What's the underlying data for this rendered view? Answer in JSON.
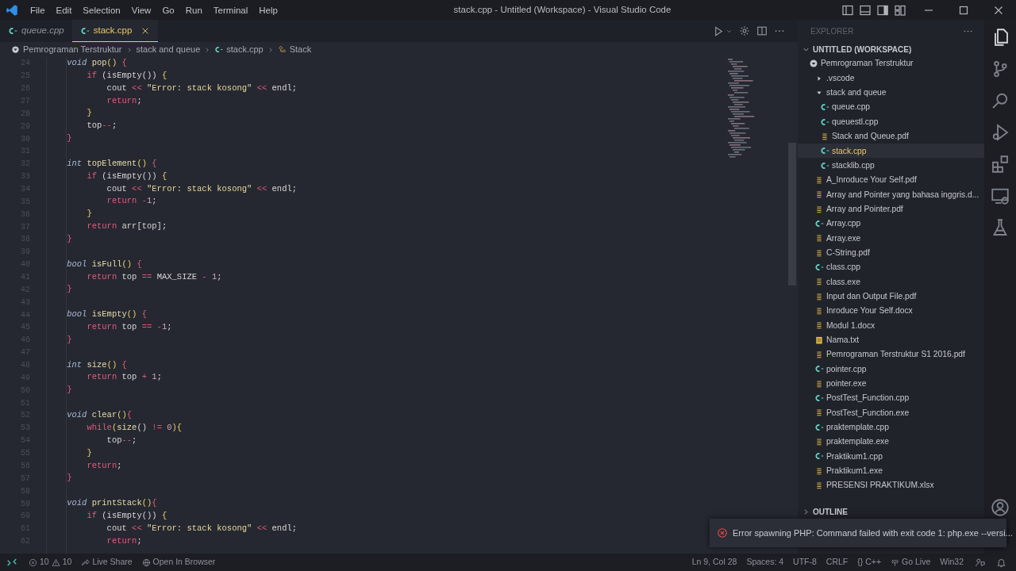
{
  "window": {
    "title": "stack.cpp - Untitled (Workspace) - Visual Studio Code"
  },
  "menu": [
    "File",
    "Edit",
    "Selection",
    "View",
    "Go",
    "Run",
    "Terminal",
    "Help"
  ],
  "tabs": [
    {
      "label": "queue.cpp",
      "selected": false,
      "preview": true
    },
    {
      "label": "stack.cpp",
      "selected": true,
      "preview": false
    }
  ],
  "breadcrumbs": [
    {
      "label": "Pemrograman Terstruktur",
      "kind": "root"
    },
    {
      "label": "stack and queue",
      "kind": "folder"
    },
    {
      "label": "stack.cpp",
      "kind": "cpp"
    },
    {
      "label": "Stack",
      "kind": "class"
    }
  ],
  "editor": {
    "lines": [
      {
        "number": "24",
        "tokens": [
          {
            "kind": "type",
            "text": "    void "
          },
          {
            "kind": "fn",
            "text": "pop"
          },
          {
            "kind": "b2",
            "text": "() "
          },
          {
            "kind": "b1",
            "text": "{"
          }
        ]
      },
      {
        "number": "25",
        "tokens": [
          {
            "kind": "kw",
            "text": "        if "
          },
          {
            "kind": "plain",
            "text": "(isEmpty()) "
          },
          {
            "kind": "b2",
            "text": "{"
          }
        ]
      },
      {
        "number": "26",
        "tokens": [
          {
            "kind": "plain",
            "text": "            cout "
          },
          {
            "kind": "op",
            "text": "<< "
          },
          {
            "kind": "str",
            "text": "\"Error: stack kosong\" "
          },
          {
            "kind": "op",
            "text": "<< "
          },
          {
            "kind": "plain",
            "text": "endl;"
          }
        ]
      },
      {
        "number": "27",
        "tokens": [
          {
            "kind": "kw",
            "text": "            return"
          },
          {
            "kind": "plain",
            "text": ";"
          }
        ]
      },
      {
        "number": "28",
        "tokens": [
          {
            "kind": "b2",
            "text": "        }"
          }
        ]
      },
      {
        "number": "29",
        "tokens": [
          {
            "kind": "plain",
            "text": "        top"
          },
          {
            "kind": "op",
            "text": "--"
          },
          {
            "kind": "plain",
            "text": ";"
          }
        ]
      },
      {
        "number": "30",
        "tokens": [
          {
            "kind": "b1",
            "text": "    }"
          }
        ]
      },
      {
        "number": "31"
      },
      {
        "number": "32",
        "tokens": [
          {
            "kind": "type",
            "text": "    int "
          },
          {
            "kind": "fn",
            "text": "topElement"
          },
          {
            "kind": "b2",
            "text": "() "
          },
          {
            "kind": "b1",
            "text": "{"
          }
        ]
      },
      {
        "number": "33",
        "tokens": [
          {
            "kind": "kw",
            "text": "        if "
          },
          {
            "kind": "plain",
            "text": "(isEmpty()) "
          },
          {
            "kind": "b2",
            "text": "{"
          }
        ]
      },
      {
        "number": "34",
        "tokens": [
          {
            "kind": "plain",
            "text": "            cout "
          },
          {
            "kind": "op",
            "text": "<< "
          },
          {
            "kind": "str",
            "text": "\"Error: stack kosong\" "
          },
          {
            "kind": "op",
            "text": "<< "
          },
          {
            "kind": "plain",
            "text": "endl;"
          }
        ]
      },
      {
        "number": "35",
        "tokens": [
          {
            "kind": "kw",
            "text": "            return "
          },
          {
            "kind": "op",
            "text": "-"
          },
          {
            "kind": "num",
            "text": "1"
          },
          {
            "kind": "plain",
            "text": ";"
          }
        ]
      },
      {
        "number": "36",
        "tokens": [
          {
            "kind": "b2",
            "text": "        }"
          }
        ]
      },
      {
        "number": "37",
        "tokens": [
          {
            "kind": "kw",
            "text": "        return "
          },
          {
            "kind": "plain",
            "text": "arr[top];"
          }
        ]
      },
      {
        "number": "38",
        "tokens": [
          {
            "kind": "b1",
            "text": "    }"
          }
        ]
      },
      {
        "number": "39"
      },
      {
        "number": "40",
        "tokens": [
          {
            "kind": "type",
            "text": "    bool "
          },
          {
            "kind": "fn",
            "text": "isFull"
          },
          {
            "kind": "b2",
            "text": "() "
          },
          {
            "kind": "b1",
            "text": "{"
          }
        ]
      },
      {
        "number": "41",
        "tokens": [
          {
            "kind": "kw",
            "text": "        return "
          },
          {
            "kind": "plain",
            "text": "top "
          },
          {
            "kind": "op",
            "text": "== "
          },
          {
            "kind": "plain",
            "text": "MAX_SIZE "
          },
          {
            "kind": "op",
            "text": "- "
          },
          {
            "kind": "num",
            "text": "1"
          },
          {
            "kind": "plain",
            "text": ";"
          }
        ]
      },
      {
        "number": "42",
        "tokens": [
          {
            "kind": "b1",
            "text": "    }"
          }
        ]
      },
      {
        "number": "43"
      },
      {
        "number": "44",
        "tokens": [
          {
            "kind": "type",
            "text": "    bool "
          },
          {
            "kind": "fn",
            "text": "isEmpty"
          },
          {
            "kind": "b2",
            "text": "() "
          },
          {
            "kind": "b1",
            "text": "{"
          }
        ]
      },
      {
        "number": "45",
        "tokens": [
          {
            "kind": "kw",
            "text": "        return "
          },
          {
            "kind": "plain",
            "text": "top "
          },
          {
            "kind": "op",
            "text": "== -"
          },
          {
            "kind": "num",
            "text": "1"
          },
          {
            "kind": "plain",
            "text": ";"
          }
        ]
      },
      {
        "number": "46",
        "tokens": [
          {
            "kind": "b1",
            "text": "    }"
          }
        ]
      },
      {
        "number": "47"
      },
      {
        "number": "48",
        "tokens": [
          {
            "kind": "type",
            "text": "    int "
          },
          {
            "kind": "fn",
            "text": "size"
          },
          {
            "kind": "b2",
            "text": "() "
          },
          {
            "kind": "b1",
            "text": "{"
          }
        ]
      },
      {
        "number": "49",
        "tokens": [
          {
            "kind": "kw",
            "text": "        return "
          },
          {
            "kind": "plain",
            "text": "top "
          },
          {
            "kind": "op",
            "text": "+ "
          },
          {
            "kind": "num",
            "text": "1"
          },
          {
            "kind": "plain",
            "text": ";"
          }
        ]
      },
      {
        "number": "50",
        "tokens": [
          {
            "kind": "b1",
            "text": "    }"
          }
        ]
      },
      {
        "number": "51"
      },
      {
        "number": "52",
        "tokens": [
          {
            "kind": "type",
            "text": "    void "
          },
          {
            "kind": "fn",
            "text": "clear"
          },
          {
            "kind": "b2",
            "text": "()"
          },
          {
            "kind": "b1",
            "text": "{"
          }
        ]
      },
      {
        "number": "53",
        "tokens": [
          {
            "kind": "kw",
            "text": "        while"
          },
          {
            "kind": "b2",
            "text": "("
          },
          {
            "kind": "fn",
            "text": "size"
          },
          {
            "kind": "plain",
            "text": "() "
          },
          {
            "kind": "op",
            "text": "!= "
          },
          {
            "kind": "num",
            "text": "0"
          },
          {
            "kind": "b2",
            "text": "){"
          }
        ]
      },
      {
        "number": "54",
        "tokens": [
          {
            "kind": "plain",
            "text": "            top"
          },
          {
            "kind": "op",
            "text": "--"
          },
          {
            "kind": "plain",
            "text": ";"
          }
        ]
      },
      {
        "number": "55",
        "tokens": [
          {
            "kind": "b2",
            "text": "        }"
          }
        ]
      },
      {
        "number": "56",
        "tokens": [
          {
            "kind": "kw",
            "text": "        return"
          },
          {
            "kind": "plain",
            "text": ";"
          }
        ]
      },
      {
        "number": "57",
        "tokens": [
          {
            "kind": "b1",
            "text": "    }"
          }
        ]
      },
      {
        "number": "58"
      },
      {
        "number": "59",
        "tokens": [
          {
            "kind": "type",
            "text": "    void "
          },
          {
            "kind": "fn",
            "text": "printStack"
          },
          {
            "kind": "b2",
            "text": "()"
          },
          {
            "kind": "b1",
            "text": "{"
          }
        ]
      },
      {
        "number": "60",
        "tokens": [
          {
            "kind": "kw",
            "text": "        if "
          },
          {
            "kind": "plain",
            "text": "(isEmpty()) "
          },
          {
            "kind": "b2",
            "text": "{"
          }
        ]
      },
      {
        "number": "61",
        "tokens": [
          {
            "kind": "plain",
            "text": "            cout "
          },
          {
            "kind": "op",
            "text": "<< "
          },
          {
            "kind": "str",
            "text": "\"Error: stack kosong\" "
          },
          {
            "kind": "op",
            "text": "<< "
          },
          {
            "kind": "plain",
            "text": "endl;"
          }
        ]
      },
      {
        "number": "62",
        "tokens": [
          {
            "kind": "kw",
            "text": "            return"
          },
          {
            "kind": "plain",
            "text": ";"
          }
        ]
      }
    ]
  },
  "explorer": {
    "title": "EXPLORER",
    "workspace": {
      "label": "UNTITLED (WORKSPACE)",
      "expanded": true
    },
    "tree": [
      {
        "label": "Pemrograman Terstruktur",
        "kind": "root",
        "selected": false,
        "children": [
          {
            "label": ".vscode",
            "kind": "folder",
            "expanded": false,
            "selected": false
          },
          {
            "label": "stack and queue",
            "kind": "folder",
            "expanded": true,
            "selected": false,
            "children": [
              {
                "label": "queue.cpp",
                "kind": "cpp",
                "selected": false
              },
              {
                "label": "queuestl.cpp",
                "kind": "cpp",
                "selected": false
              },
              {
                "label": "Stack and Queue.pdf",
                "kind": "doc",
                "selected": false
              },
              {
                "label": "stack.cpp",
                "kind": "cpp",
                "selected": true
              },
              {
                "label": "stacklib.cpp",
                "kind": "cpp",
                "selected": false
              }
            ]
          },
          {
            "label": "A_Inroduce Your Self.pdf",
            "kind": "doc",
            "selected": false
          },
          {
            "label": "Array and Pointer yang bahasa inggris.d...",
            "kind": "doc",
            "selected": false
          },
          {
            "label": "Array and Pointer.pdf",
            "kind": "doc",
            "selected": false
          },
          {
            "label": "Array.cpp",
            "kind": "cpp",
            "selected": false
          },
          {
            "label": "Array.exe",
            "kind": "doc",
            "selected": false
          },
          {
            "label": "C-String.pdf",
            "kind": "doc",
            "selected": false
          },
          {
            "label": "class.cpp",
            "kind": "cpp",
            "selected": false
          },
          {
            "label": "class.exe",
            "kind": "doc",
            "selected": false
          },
          {
            "label": "Input dan Output File.pdf",
            "kind": "doc",
            "selected": false
          },
          {
            "label": "Inroduce Your Self.docx",
            "kind": "doc",
            "selected": false
          },
          {
            "label": "Modul 1.docx",
            "kind": "doc",
            "selected": false
          },
          {
            "label": "Nama.txt",
            "kind": "txt",
            "selected": false
          },
          {
            "label": "Pemrograman Terstruktur S1 2016.pdf",
            "kind": "doc",
            "selected": false
          },
          {
            "label": "pointer.cpp",
            "kind": "cpp",
            "selected": false
          },
          {
            "label": "pointer.exe",
            "kind": "doc",
            "selected": false
          },
          {
            "label": "PostTest_Function.cpp",
            "kind": "cpp",
            "selected": false
          },
          {
            "label": "PostTest_Function.exe",
            "kind": "doc",
            "selected": false
          },
          {
            "label": "praktemplate.cpp",
            "kind": "cpp",
            "selected": false
          },
          {
            "label": "praktemplate.exe",
            "kind": "doc",
            "selected": false
          },
          {
            "label": "Praktikum1.cpp",
            "kind": "cpp",
            "selected": false
          },
          {
            "label": "Praktikum1.exe",
            "kind": "doc",
            "selected": false
          },
          {
            "label": "PRESENSI PRAKTIKUM.xlsx",
            "kind": "doc",
            "selected": false
          }
        ]
      }
    ],
    "sections": [
      {
        "label": "OUTLINE",
        "expanded": false
      }
    ]
  },
  "notification": {
    "message": "Error spawning PHP: Command failed with exit code 1: php.exe --versi..."
  },
  "status_bar": {
    "left": [
      {
        "kind": "remote"
      },
      {
        "kind": "problems",
        "errors": "10",
        "warnings": "10"
      },
      {
        "kind": "liveshare",
        "label": "Live Share"
      },
      {
        "kind": "browser",
        "label": "Open In Browser"
      }
    ],
    "right": [
      {
        "kind": "text",
        "label": "Ln 9, Col 28"
      },
      {
        "kind": "text",
        "label": "Spaces: 4"
      },
      {
        "kind": "text",
        "label": "UTF-8"
      },
      {
        "kind": "text",
        "label": "CRLF"
      },
      {
        "kind": "text",
        "label": "{} C++"
      },
      {
        "kind": "golive",
        "label": "Go Live"
      },
      {
        "kind": "text",
        "label": "Win32"
      },
      {
        "kind": "feedback"
      },
      {
        "kind": "bell"
      }
    ]
  }
}
